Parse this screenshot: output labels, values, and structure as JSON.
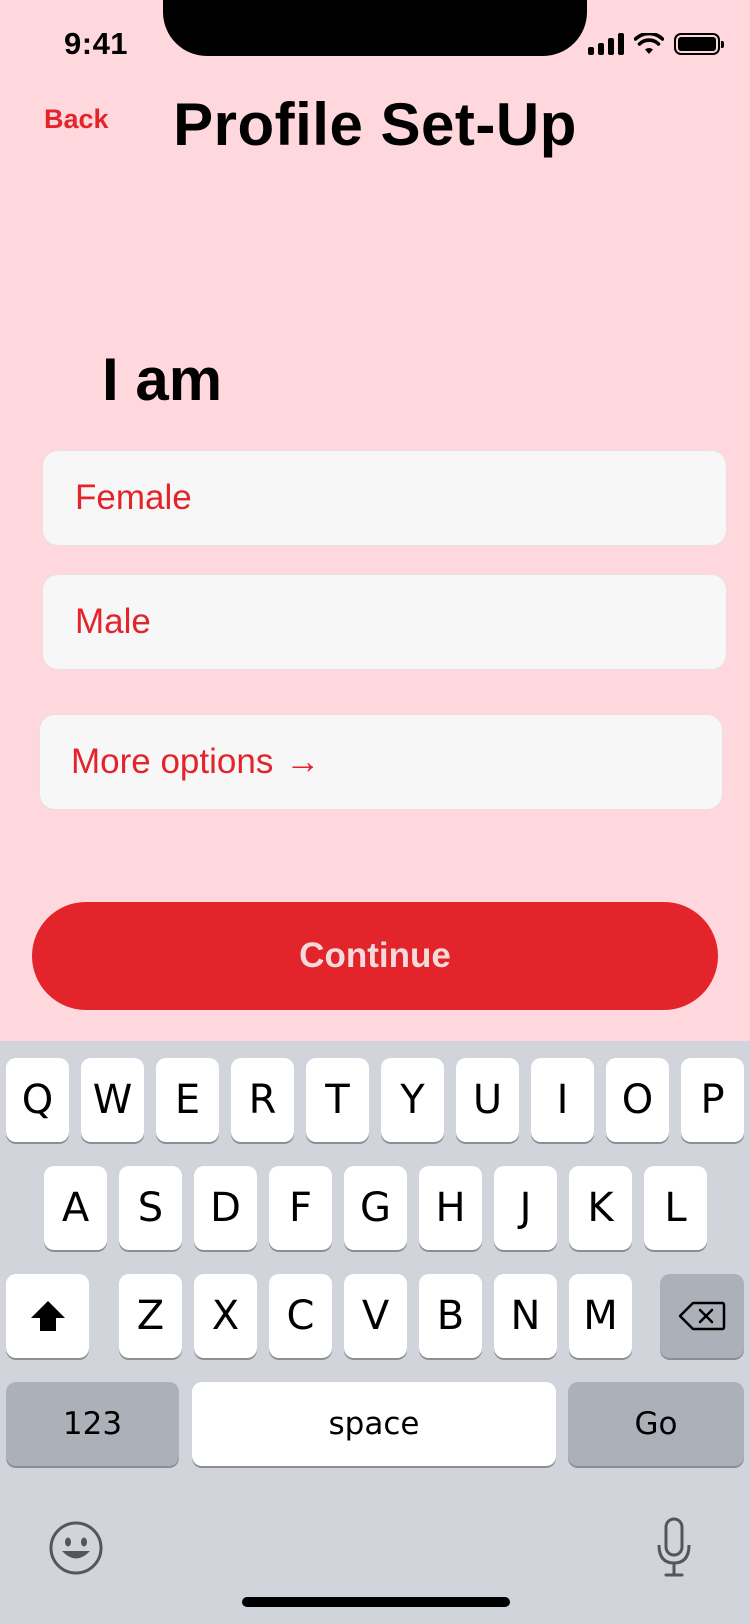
{
  "status": {
    "time": "9:41"
  },
  "header": {
    "back": "Back",
    "title": "Profile Set-Up"
  },
  "question": "I am",
  "options": [
    "Female",
    "Male"
  ],
  "more_options": {
    "label": "More options",
    "arrow": "→"
  },
  "continue_label": "Continue",
  "keyboard": {
    "row1": [
      "Q",
      "W",
      "E",
      "R",
      "T",
      "Y",
      "U",
      "I",
      "O",
      "P"
    ],
    "row2": [
      "A",
      "S",
      "D",
      "F",
      "G",
      "H",
      "J",
      "K",
      "L"
    ],
    "row3": [
      "Z",
      "X",
      "C",
      "V",
      "B",
      "N",
      "M"
    ],
    "numbers": "123",
    "space": "space",
    "go": "Go"
  },
  "colors": {
    "background": "#ffd8de",
    "accent": "#e3242b",
    "keyboard": "#d1d4da"
  },
  "icons": [
    "signal-icon",
    "wifi-icon",
    "battery-icon",
    "shift-icon",
    "backspace-icon",
    "emoji-icon",
    "microphone-icon"
  ]
}
